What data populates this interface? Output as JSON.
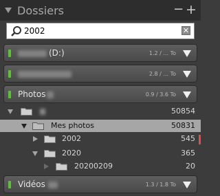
{
  "header": {
    "title": "Dossiers",
    "minus": "−",
    "plus": "+"
  },
  "search": {
    "value": "2002",
    "clear": "✕"
  },
  "volumes": [
    {
      "name": "(D:)",
      "size": "1.2 / ... To"
    },
    {
      "name": "",
      "size": "2.8 / ... To"
    },
    {
      "name": "Photos",
      "size": "0.9 / 3.6 To"
    },
    {
      "name": "Vidéos",
      "size": "1.3 / 1.8 To"
    }
  ],
  "tree": [
    {
      "label": "",
      "count": "50854"
    },
    {
      "label": "Mes photos",
      "count": "50831"
    },
    {
      "label": "2002",
      "count": "545"
    },
    {
      "label": "2020",
      "count": "365"
    },
    {
      "label": "20200209",
      "count": "20"
    }
  ],
  "colors": {
    "led": "#5fbf3a",
    "marker": "#e34b4b",
    "selected": "#a6a6a6"
  },
  "icons": [
    "collapse-triangle-icon",
    "magnifier-icon",
    "clear-icon",
    "folder-icon",
    "disclosure-triangle-icon"
  ]
}
